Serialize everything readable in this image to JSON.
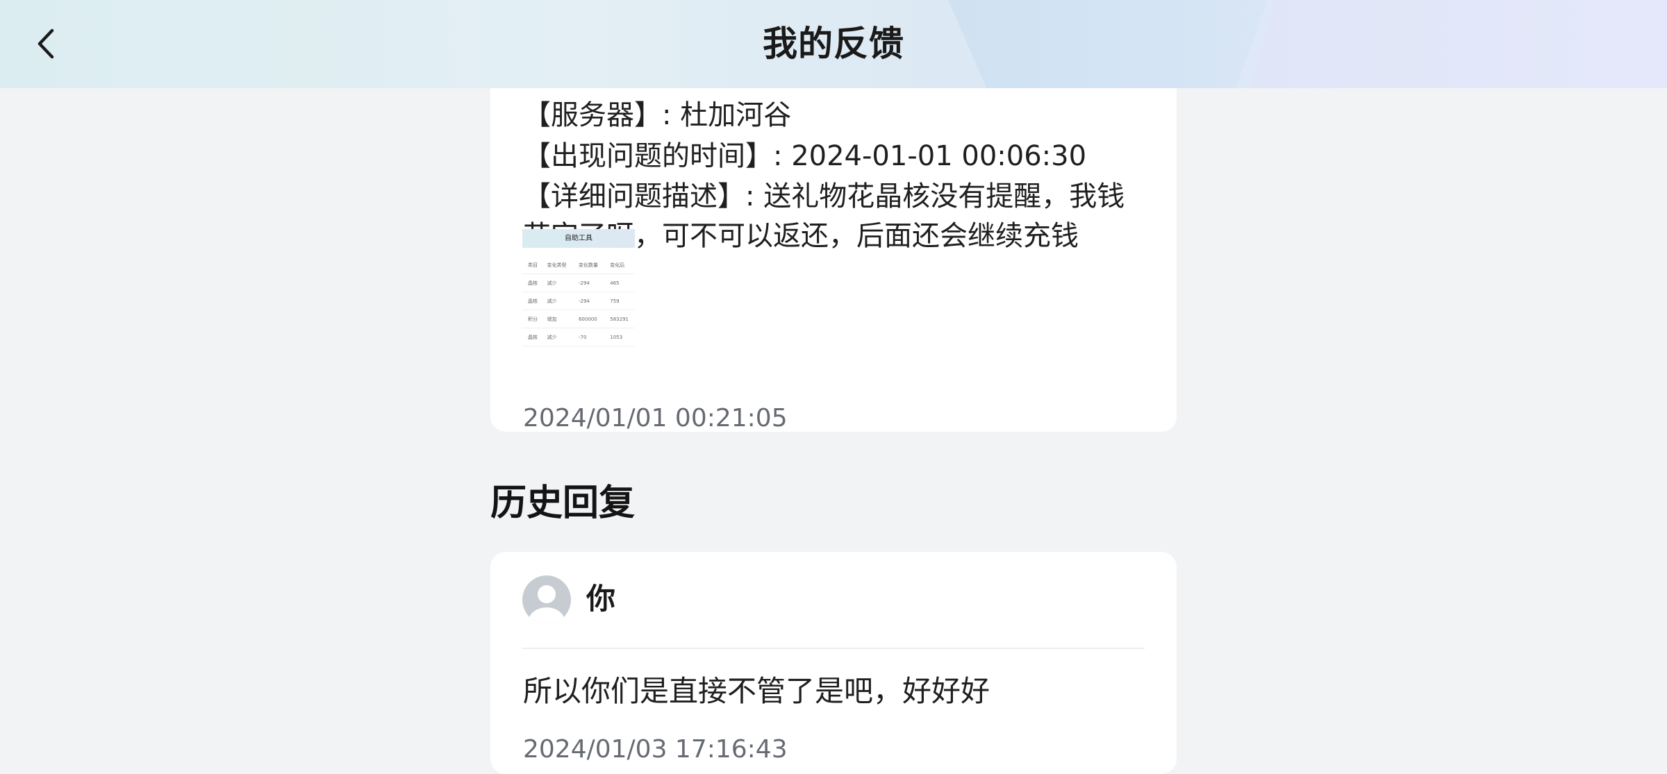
{
  "header": {
    "title": "我的反馈",
    "back_icon": "chevron-left-icon"
  },
  "feedback": {
    "lines": [
      "【服务器】: 杜加河谷",
      "【出现问题的时间】: 2024-01-01 00:06:30",
      "【详细问题描述】: 送礼物花晶核没有提醒，我钱",
      "花完了呀，可不可以返还，后面还会继续充钱"
    ],
    "attachment": {
      "title": "自助工具",
      "headers": [
        "类目",
        "变化类型",
        "变化数量",
        "变化后"
      ],
      "rows": [
        [
          "晶核",
          "减少",
          "-294",
          "465"
        ],
        [
          "晶核",
          "减少",
          "-294",
          "759"
        ],
        [
          "积分",
          "增加",
          "600000",
          "583291"
        ],
        [
          "晶核",
          "减少",
          "-70",
          "1053"
        ]
      ]
    },
    "time": "2024/01/01 00:21:05"
  },
  "history": {
    "title": "历史回复",
    "replies": [
      {
        "name": "你",
        "text": "所以你们是直接不管了是吧，好好好",
        "time": "2024/01/03 17:16:43"
      }
    ]
  },
  "colors": {
    "page_bg": "#f2f3f5",
    "card_bg": "#ffffff",
    "muted_text": "#666a72"
  }
}
